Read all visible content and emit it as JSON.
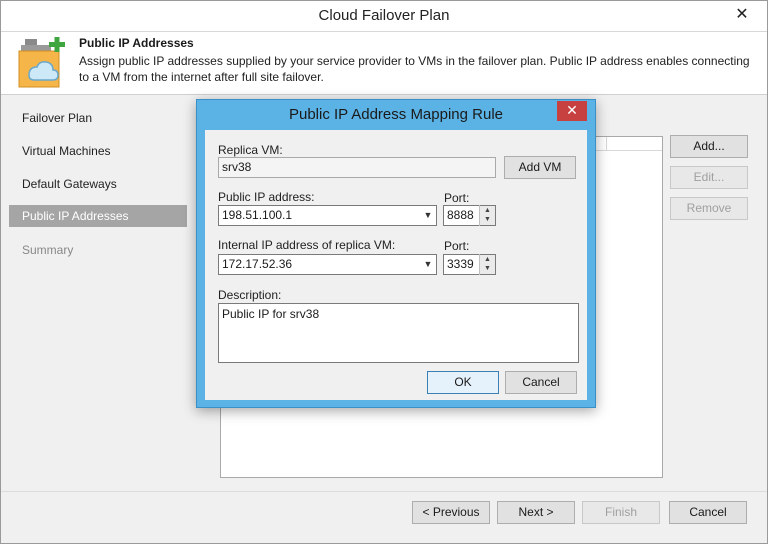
{
  "window": {
    "title": "Cloud Failover Plan",
    "close_glyph": "✕"
  },
  "header": {
    "title": "Public IP Addresses",
    "description": "Assign public IP addresses supplied by your service provider to VMs in the failover plan. Public IP address enables connecting to a VM from the internet after full site failover.",
    "icon": "cloud-plus-icon"
  },
  "nav": {
    "items": [
      {
        "label": "Failover Plan"
      },
      {
        "label": "Virtual Machines"
      },
      {
        "label": "Default Gateways"
      },
      {
        "label": "Public IP Addresses"
      },
      {
        "label": "Summary"
      }
    ]
  },
  "side_buttons": {
    "add": "Add...",
    "edit": "Edit...",
    "remove": "Remove"
  },
  "footer": {
    "previous": "< Previous",
    "next": "Next >",
    "finish": "Finish",
    "cancel": "Cancel"
  },
  "dialog": {
    "title": "Public IP Address Mapping Rule",
    "close_glyph": "✕",
    "replica_vm_label": "Replica VM:",
    "replica_vm_value": "srv38",
    "add_vm": "Add VM",
    "public_ip_label": "Public IP address:",
    "public_ip_value": "198.51.100.1",
    "port_label": "Port:",
    "public_port_value": "8888",
    "internal_ip_label": "Internal IP address of replica VM:",
    "internal_ip_value": "172.17.52.36",
    "internal_port_value": "3339",
    "description_label": "Description:",
    "description_value": "Public IP for srv38",
    "ok": "OK",
    "cancel": "Cancel"
  }
}
